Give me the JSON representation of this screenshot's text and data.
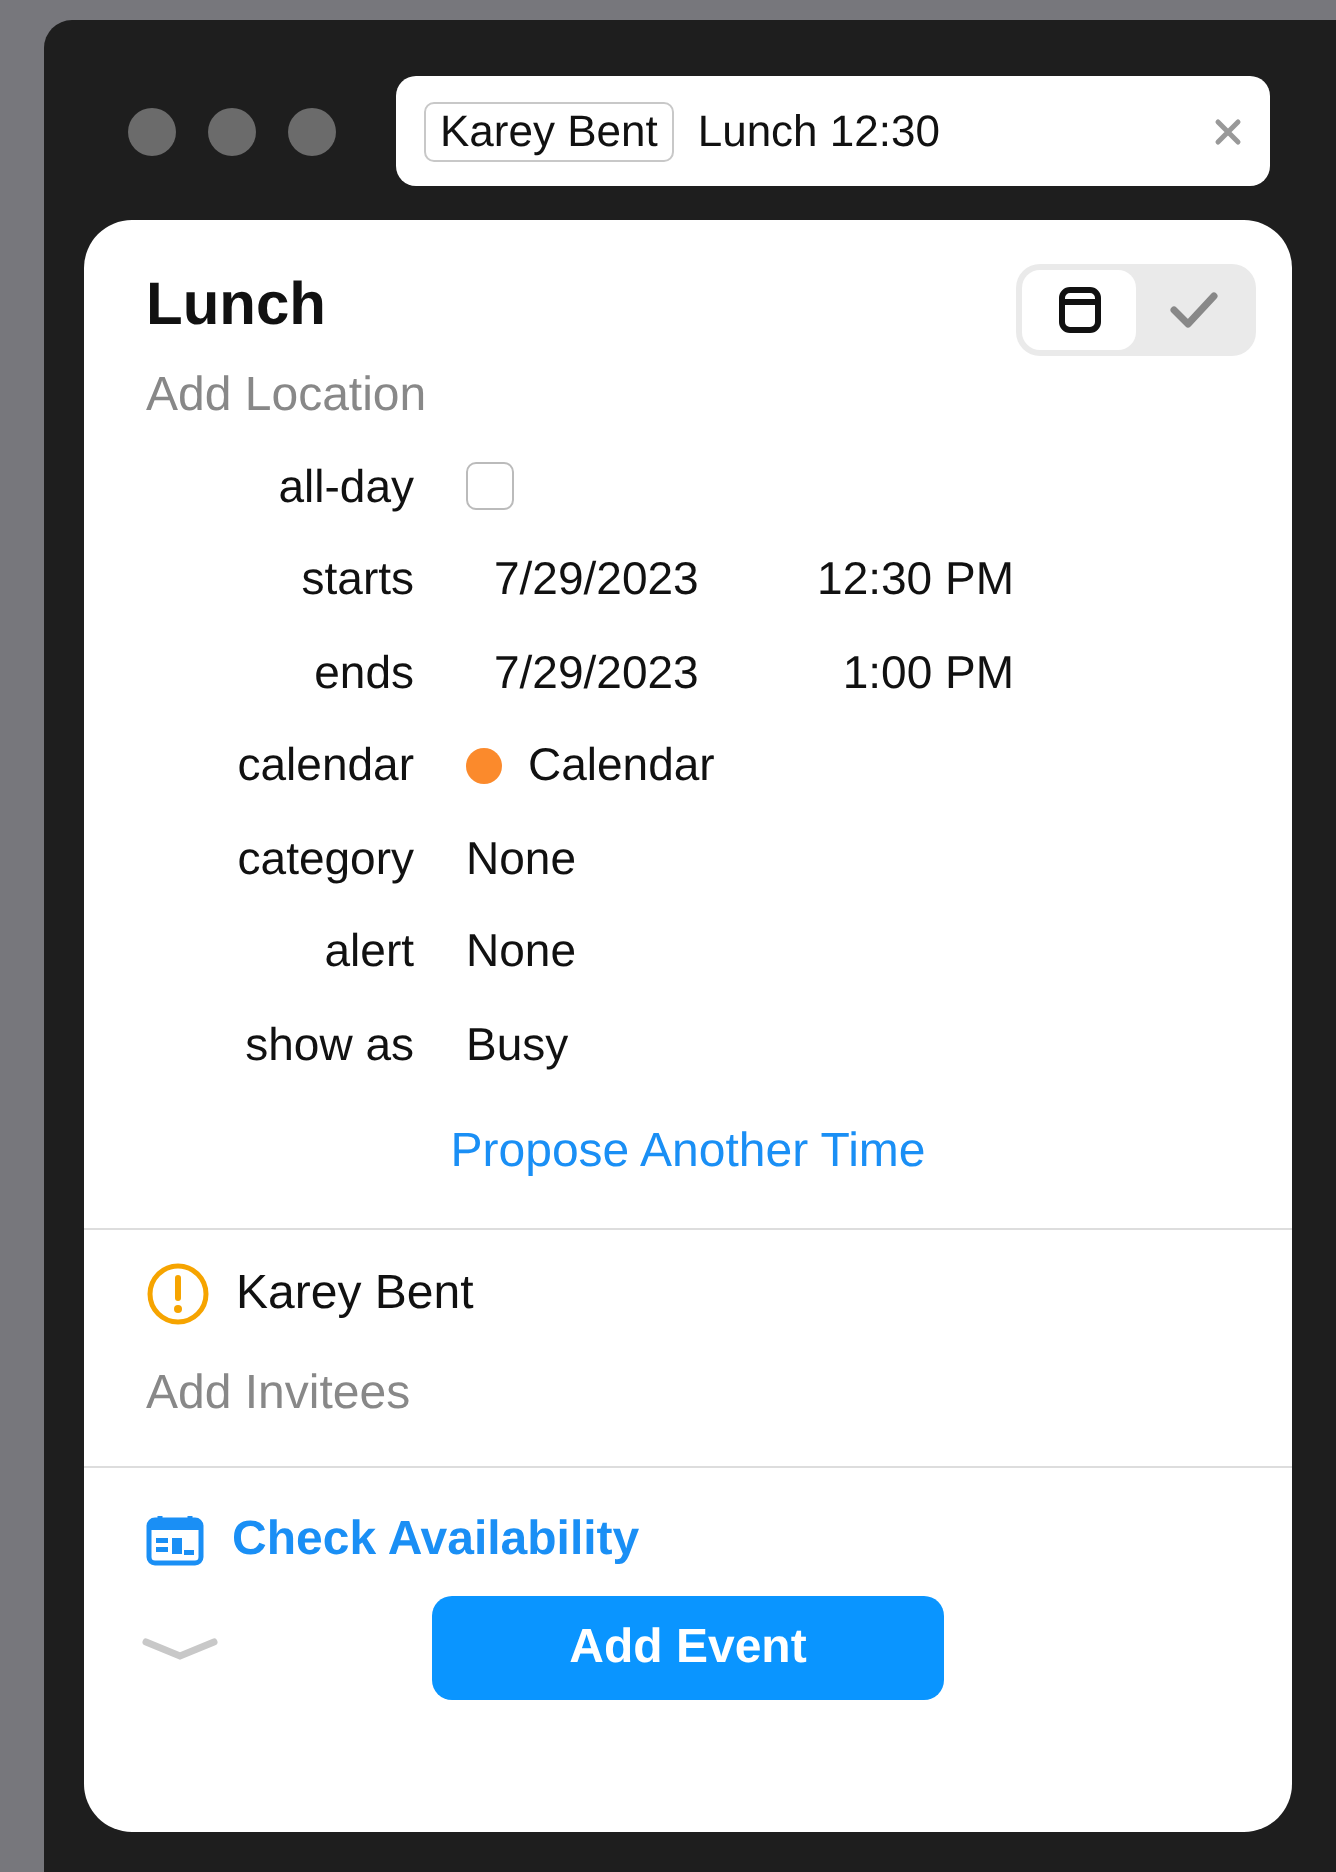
{
  "search": {
    "token": "Karey Bent",
    "text": "Lunch 12:30"
  },
  "event": {
    "title": "Lunch",
    "location_placeholder": "Add Location",
    "view_toggle": [
      {
        "kind": "calendar",
        "selected": true
      },
      {
        "kind": "check",
        "selected": false
      }
    ],
    "fields": [
      {
        "kind": "checkbox",
        "label": "all-day",
        "checked": false
      },
      {
        "kind": "datetime",
        "label": "starts",
        "date": "7/29/2023",
        "time": "12:30 PM"
      },
      {
        "kind": "datetime",
        "label": "ends",
        "date": "7/29/2023",
        "time": "1:00 PM"
      },
      {
        "kind": "calendar",
        "label": "calendar",
        "value": "Calendar",
        "color": "#fb8a2c"
      },
      {
        "kind": "text",
        "label": "category",
        "value": "None"
      },
      {
        "kind": "text",
        "label": "alert",
        "value": "None"
      },
      {
        "kind": "text",
        "label": "show as",
        "value": "Busy"
      }
    ],
    "propose_link": "Propose Another Time"
  },
  "invitees": [
    {
      "name": "Karey Bent"
    }
  ],
  "add_invitees_placeholder": "Add Invitees",
  "check_availability": "Check Availability",
  "add_button": "Add Event"
}
